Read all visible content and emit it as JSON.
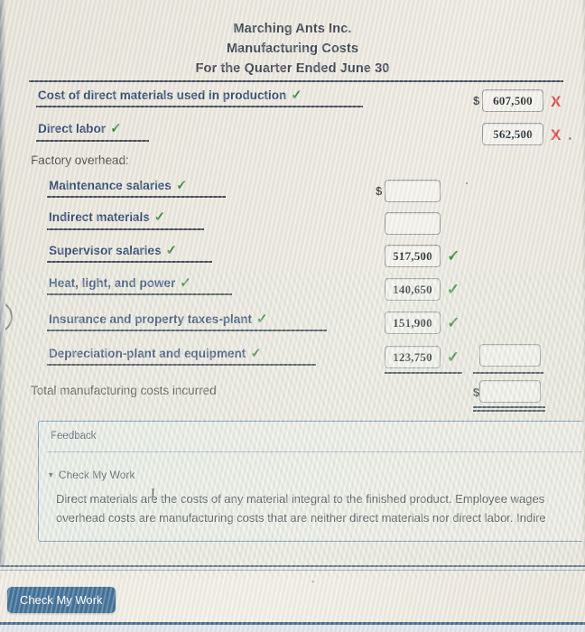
{
  "statement": {
    "company": "Marching Ants Inc.",
    "report": "Manufacturing Costs",
    "period": "For the Quarter Ended June 30"
  },
  "colors": {
    "label": "#1f3864",
    "correct": "#2e7d32",
    "incorrect": "#e03232",
    "rule": "#2f3a46",
    "button": "#2d628f",
    "feedback_border": "#5b7fb5"
  },
  "symbols": {
    "check": "✓",
    "cross": "X",
    "dollar": "$",
    "triangle_down": "▼",
    "text_caret": "I"
  },
  "rows": [
    {
      "label": "Cost of direct materials used in production",
      "label_status": "correct",
      "label_mark": "✓",
      "has_dollar": true,
      "dollar": "$",
      "value": "607,500",
      "value_status": "incorrect",
      "value_mark": "X",
      "column": "primary",
      "indent": 0
    },
    {
      "label": "Direct labor",
      "label_status": "correct",
      "label_mark": "✓",
      "has_dollar": false,
      "dollar": "",
      "value": "562,500",
      "value_status": "incorrect",
      "value_mark": "X",
      "column": "primary",
      "indent": 0
    },
    {
      "label": "Factory overhead:",
      "label_status": "none",
      "label_mark": "",
      "has_dollar": false,
      "dollar": "",
      "value": "",
      "value_status": "none",
      "value_mark": "",
      "column": "none",
      "indent": 0
    },
    {
      "label": "Maintenance salaries",
      "label_status": "correct",
      "label_mark": "✓",
      "has_dollar": true,
      "dollar": "$",
      "value": "",
      "value_status": "none",
      "value_mark": "",
      "column": "detail",
      "indent": 1
    },
    {
      "label": "Indirect materials",
      "label_status": "correct",
      "label_mark": "✓",
      "has_dollar": false,
      "dollar": "",
      "value": "",
      "value_status": "none",
      "value_mark": "",
      "column": "detail",
      "indent": 1
    },
    {
      "label": "Supervisor salaries",
      "label_status": "correct",
      "label_mark": "✓",
      "has_dollar": false,
      "dollar": "",
      "value": "517,500",
      "value_status": "correct",
      "value_mark": "✓",
      "column": "detail",
      "indent": 1
    },
    {
      "label": "Heat, light, and power",
      "label_status": "correct",
      "label_mark": "✓",
      "has_dollar": false,
      "dollar": "",
      "value": "140,650",
      "value_status": "correct",
      "value_mark": "✓",
      "column": "detail",
      "indent": 1
    },
    {
      "label": "Insurance and property taxes-plant",
      "label_status": "correct",
      "label_mark": "✓",
      "has_dollar": false,
      "dollar": "",
      "value": "151,900",
      "value_status": "correct",
      "value_mark": "✓",
      "column": "detail",
      "indent": 1
    },
    {
      "label": "Depreciation-plant and equipment",
      "label_status": "correct",
      "label_mark": "✓",
      "has_dollar": false,
      "dollar": "",
      "value": "123,750",
      "value_status": "correct",
      "value_mark": "✓",
      "column": "detail",
      "indent": 1,
      "subtotal_value": ""
    },
    {
      "label": "Total manufacturing costs incurred",
      "label_status": "none",
      "label_mark": "",
      "has_dollar": true,
      "dollar": "$",
      "value": "",
      "value_status": "none",
      "value_mark": "",
      "column": "total",
      "indent": 0
    }
  ],
  "feedback": {
    "title": "Feedback",
    "check_my_work_toggle": "Check My Work",
    "line1": "Direct materials are the costs of any material integral to the finished product. Employee wages",
    "line2": "overhead costs are manufacturing costs that are neither direct materials nor direct labor. Indire"
  },
  "bottom": {
    "check_my_work_button": "Check My Work"
  }
}
